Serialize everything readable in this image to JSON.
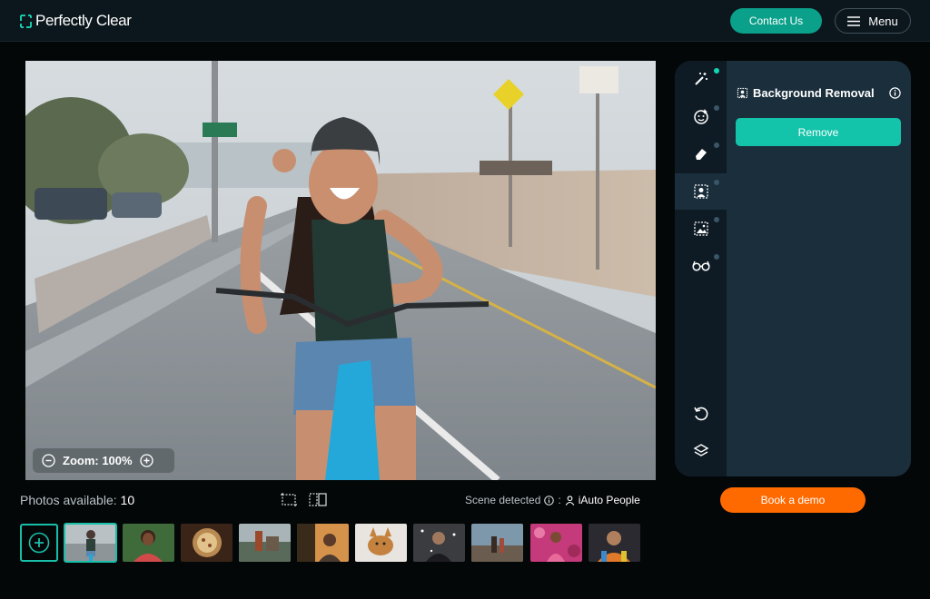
{
  "header": {
    "logo_text": "Perfectly Clear",
    "contact_label": "Contact Us",
    "menu_label": "Menu"
  },
  "viewer": {
    "zoom_label": "Zoom: 100%"
  },
  "panel": {
    "title": "Background Removal",
    "remove_label": "Remove",
    "tools": [
      {
        "icon": "magic-wand-icon",
        "active": false,
        "dot": "on"
      },
      {
        "icon": "face-retouch-icon",
        "active": false,
        "dot": "off"
      },
      {
        "icon": "eraser-icon",
        "active": false,
        "dot": "off"
      },
      {
        "icon": "portrait-select-icon",
        "active": true,
        "dot": "off"
      },
      {
        "icon": "image-select-icon",
        "active": false,
        "dot": "off"
      },
      {
        "icon": "glasses-icon",
        "active": false,
        "dot": "off"
      },
      {
        "icon": "undo-icon"
      },
      {
        "icon": "layers-icon"
      }
    ]
  },
  "book_demo_label": "Book a demo",
  "footer": {
    "photos_label": "Photos available:",
    "photos_count": "10",
    "scene_label": "Scene detected",
    "scene_separator": ":",
    "scene_value": "iAuto People"
  },
  "colors": {
    "accent": "#14c4aa",
    "orange": "#ff6a00",
    "panel": "#1a2e3c"
  },
  "thumbnails": [
    {
      "name": "cyclist",
      "selected": true
    },
    {
      "name": "portrait-woman",
      "selected": false
    },
    {
      "name": "food-bowl",
      "selected": false
    },
    {
      "name": "city-aerial",
      "selected": false
    },
    {
      "name": "sunset-portrait",
      "selected": false
    },
    {
      "name": "dog",
      "selected": false
    },
    {
      "name": "snow-portrait",
      "selected": false
    },
    {
      "name": "beach-people",
      "selected": false
    },
    {
      "name": "flower-portrait",
      "selected": false
    },
    {
      "name": "colorful-portrait",
      "selected": false
    }
  ]
}
